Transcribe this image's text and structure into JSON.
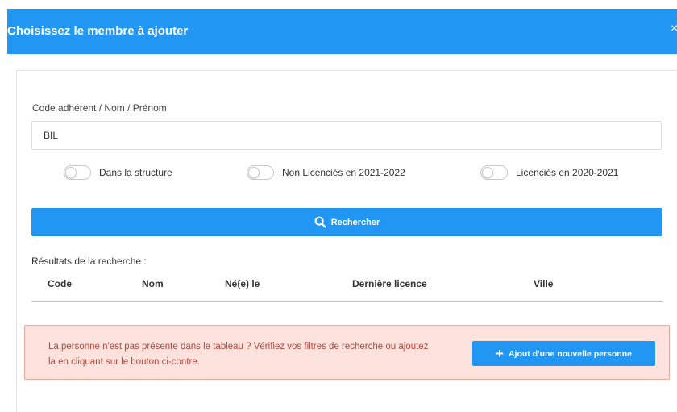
{
  "header": {
    "title": "Choisissez le membre à ajouter",
    "close_glyph": "×"
  },
  "search": {
    "label": "Code adhérent / Nom / Prénom",
    "value": "BIL",
    "placeholder": ""
  },
  "filters": [
    {
      "label": "Dans la structure",
      "checked": false
    },
    {
      "label": "Non Licenciés en 2021-2022",
      "checked": false
    },
    {
      "label": "Licenciés en 2020-2021",
      "checked": false
    }
  ],
  "search_button": {
    "label": "Rechercher",
    "icon": "search-icon"
  },
  "results": {
    "title": "Résultats de la recherche :",
    "columns": [
      "Code",
      "Nom",
      "Né(e) le",
      "Dernière licence",
      "Ville"
    ]
  },
  "alert": {
    "message": "La personne n'est pas présente dans le tableau ? Vérifiez vos filtres de recherche ou ajoutez la en cliquant sur le bouton ci-contre.",
    "button_label": "Ajout d'une nouvelle personne",
    "button_icon": "plus-icon"
  },
  "colors": {
    "primary": "#2196f3",
    "alert_bg": "#fde2dd",
    "alert_border": "#f0a99b",
    "alert_text": "#b8463a"
  }
}
